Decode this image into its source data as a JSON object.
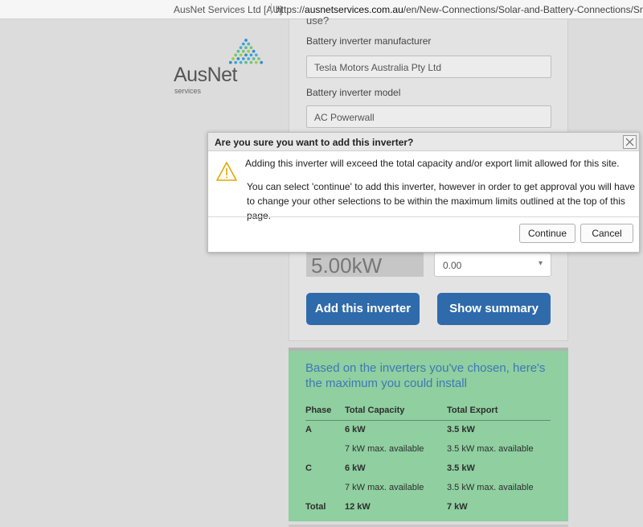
{
  "browser": {
    "site_identity": "AusNet Services Ltd [AU]",
    "url_prefix": "https://",
    "url_host": "ausnetservices.com.au",
    "url_path": "/en/New-Connections/Solar-and-Battery-Connections/Small-Simple-"
  },
  "logo": {
    "word": "AusNet",
    "sub": "services"
  },
  "form": {
    "cut_text": "use?",
    "manufacturer_label": "Battery inverter manufacturer",
    "manufacturer_value": "Tesla Motors Australia Pty Ltd",
    "model_label": "Battery inverter model",
    "model_value": "AC Powerwall",
    "capacity_display": "5.00kW",
    "export_select_value": "0.00",
    "add_button": "Add this inverter",
    "summary_button": "Show summary"
  },
  "summary": {
    "title": "Based on the inverters you've chosen, here's the maximum you could install",
    "headers": [
      "Phase",
      "Total Capacity",
      "Total Export"
    ],
    "rows": [
      {
        "phase": "A",
        "capacity": "6 kW",
        "export": "3.5 kW",
        "bold": true
      },
      {
        "phase": "",
        "capacity": "7 kW max. available",
        "export": "3.5 kW max. available",
        "bold": false
      },
      {
        "phase": "C",
        "capacity": "6 kW",
        "export": "3.5 kW",
        "bold": true
      },
      {
        "phase": "",
        "capacity": "7 kW max. available",
        "export": "3.5 kW max. available",
        "bold": false
      },
      {
        "phase": "Total",
        "capacity": "12 kW",
        "export": "7 kW",
        "bold": true
      }
    ]
  },
  "modal": {
    "title": "Are you sure you want to add this inverter?",
    "message_1": "Adding this inverter will exceed the total capacity and/or export limit allowed for this site.",
    "message_2": "You can select 'continue' to add this inverter, however in order to get approval you will have to change your other selections to be within the maximum limits outlined at the top of this page.",
    "continue_label": "Continue",
    "cancel_label": "Cancel"
  },
  "colors": {
    "primary_button": "#2f6bab",
    "summary_bg": "#8fcfa0",
    "summary_title": "#3f78b5",
    "warning": "#e0a800"
  },
  "icons": [
    "ausnet-logo-icon",
    "warning-icon",
    "close-icon",
    "chevron-down-icon"
  ]
}
